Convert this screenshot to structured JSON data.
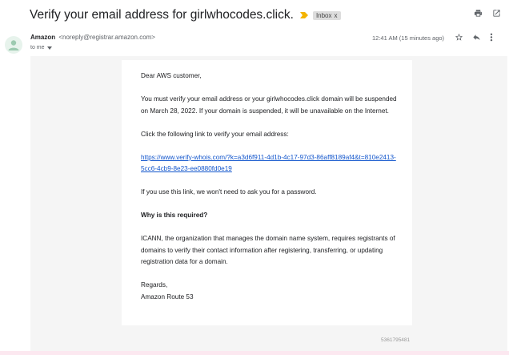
{
  "subject": "Verify your email address for girlwhocodes.click.",
  "label": {
    "text": "Inbox",
    "remove": "x"
  },
  "sender": {
    "name": "Amazon",
    "email": "<noreply@registrar.amazon.com>",
    "to": "to me"
  },
  "timestamp": "12:41 AM (15 minutes ago)",
  "body": {
    "greeting": "Dear AWS customer,",
    "para1": "You must verify your email address or your girlwhocodes.click domain will be suspended on March 28, 2022. If your domain is suspended, it will be unavailable on the Internet.",
    "para2": "Click the following link to verify your email address:",
    "link": "https://www.verify-whois.com/?k=a3d6f911-4d1b-4c17-97d3-86aff8189af4&t=810e2413-5cc6-4cb9-8e23-ee0880fd0e19",
    "para3": "If you use this link, we won't need to ask you for a password.",
    "heading": "Why is this required?",
    "para4": "ICANN, the organization that manages the domain name system, requires registrants of domains to verify their contact information after registering, transferring, or updating registration data for a domain.",
    "regards": "Regards,",
    "signature": "Amazon Route 53"
  },
  "footer_id": "5361795481",
  "icons": [
    "importance-marker-icon",
    "print-icon",
    "open-in-new-window-icon",
    "avatar-person-icon",
    "dropdown-arrow-icon",
    "star-icon",
    "reply-icon",
    "more-options-icon"
  ],
  "colors": {
    "importance": "#f4b400",
    "link": "#1155cc",
    "label_bg": "#dddddd"
  }
}
